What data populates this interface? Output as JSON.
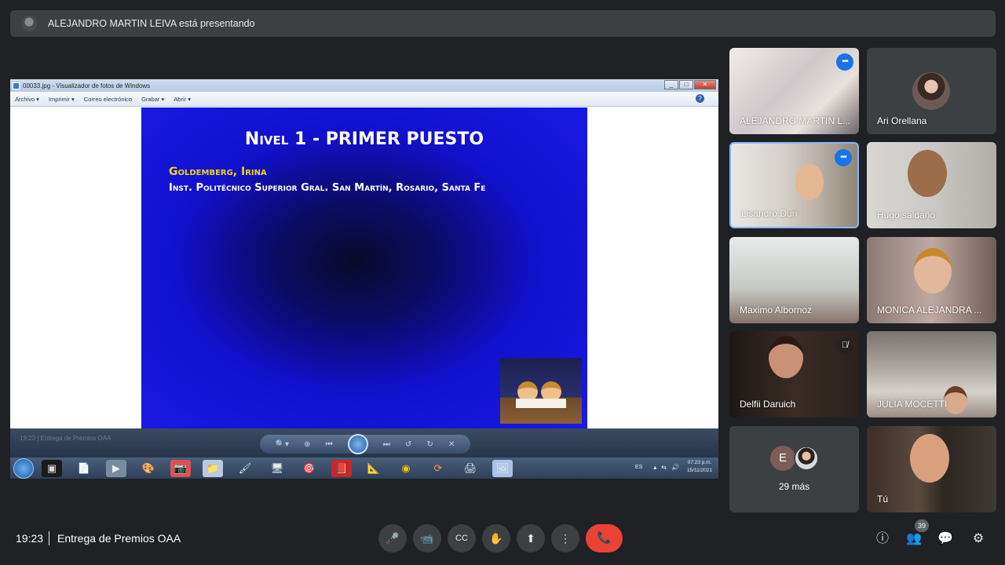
{
  "banner": {
    "text": "ALEJANDRO MARTIN LEIVA está presentando"
  },
  "screen": {
    "window_title": "00033.jpg - Visualizador de fotos de Windows",
    "window_controls": [
      "_",
      "□",
      "✕"
    ],
    "menu": [
      "Archivo ▾",
      "Imprimir ▾",
      "Correo electrónico",
      "Grabar ▾",
      "Abrir ▾"
    ],
    "help": "?",
    "slide": {
      "title": "Nivel 1 - PRIMER PUESTO",
      "name": "Goldemberg, Irina",
      "institution": "Inst. Politécnico Superior Gral. San Martín, Rosario, Santa Fe",
      "background_color": "#1a1ae6",
      "name_color": "#f5d21e"
    },
    "viewer_dim_text": "19:23 | Entrega de Premios OAA",
    "viewer_controls": [
      "🔍▾",
      "⊕",
      "⏮",
      "⏭",
      "↺",
      "↻",
      "✕"
    ],
    "taskbar_icons": [
      "▣",
      "📄",
      "▶",
      "🎨",
      "📷",
      "📁",
      "🖌",
      "🖥",
      "🎯",
      "📕",
      "📐",
      "◉",
      "⟳",
      "🖨",
      "🖼"
    ],
    "tray": {
      "lang": "ES",
      "icons": [
        "▴",
        "⇆",
        "🔊"
      ],
      "time": "07:23 p.m.",
      "date": "15/11/2021"
    }
  },
  "participants": [
    {
      "name": "ALEJANDRO MARTIN L...",
      "speaking": false,
      "speaker_icon": "•••"
    },
    {
      "name": "Ari Orellana"
    },
    {
      "name": "Lisandro Duri",
      "speaking": true,
      "speaker_icon": "•••"
    },
    {
      "name": "Hugo saldaño"
    },
    {
      "name": "Maximo Albornoz"
    },
    {
      "name": "MONICA ALEJANDRA ..."
    },
    {
      "name": "Delfii Daruich",
      "muted_icon": "🎙̸"
    },
    {
      "name": "JULIA MOCETTI"
    },
    {
      "more_initial": "E",
      "more_text": "29 más"
    },
    {
      "name": "Tú"
    }
  ],
  "bottom": {
    "time": "19:23",
    "meeting": "Entrega de Premios OAA",
    "controls": {
      "mic": "🎤",
      "camera": "📹",
      "captions": "CC",
      "hand": "✋",
      "present": "⬆",
      "more": "⋮",
      "end": "📞"
    },
    "right": {
      "info": "ⓘ",
      "people": "👥",
      "people_count": "39",
      "chat": "💬",
      "activities": "⚙"
    }
  }
}
